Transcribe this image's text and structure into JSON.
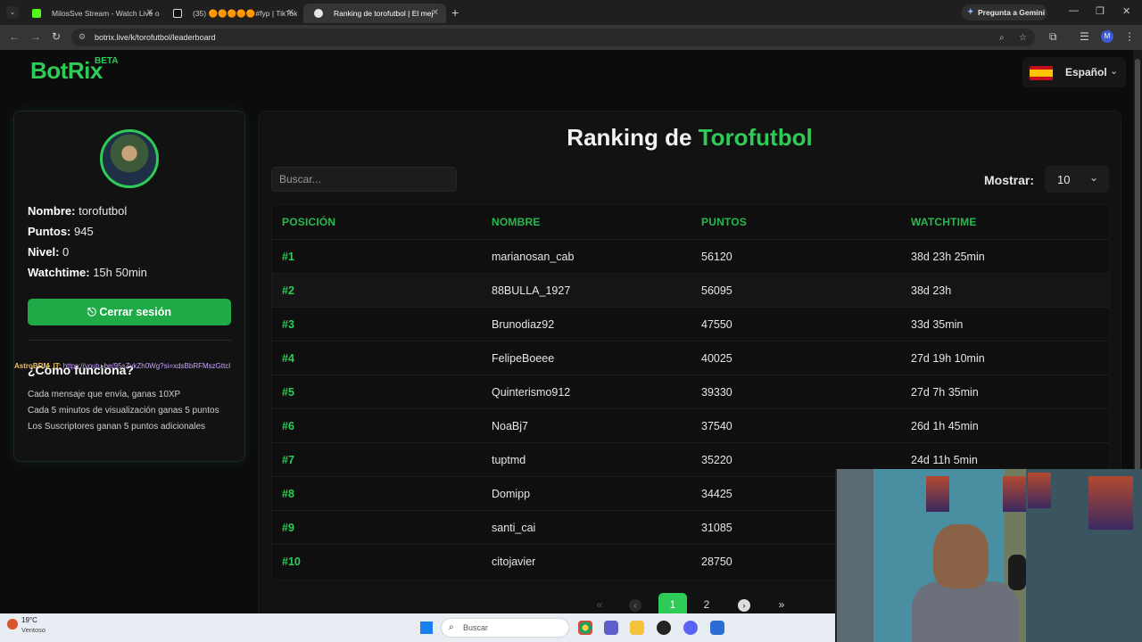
{
  "browser": {
    "tabs": [
      {
        "title": "MilosSve Stream - Watch Live o",
        "favicon_color": "#53fc18",
        "active": false
      },
      {
        "title": "(35) 🟠🟠🟠🟠🟠#fyp | TikTok",
        "favicon_color": "#ffffff",
        "active": false
      },
      {
        "title": "Ranking de torofutbol | El mej",
        "favicon_color": "#e6e6e6",
        "active": true
      }
    ],
    "gemini_label": "Pregunta a Gemini",
    "url": "botrix.live/k/torofutbol/leaderboard",
    "profile_initial": "M"
  },
  "site": {
    "logo": "BotRix",
    "beta": "BETA",
    "language": "Español"
  },
  "profile": {
    "name_label": "Nombre:",
    "name_value": "torofutbol",
    "points_label": "Puntos:",
    "points_value": "945",
    "level_label": "Nivel:",
    "level_value": "0",
    "watchtime_label": "Watchtime:",
    "watchtime_value": "15h 50min",
    "logout_label": "Cerrar sesión"
  },
  "how_it_works": {
    "title": "¿Cómo funciona?",
    "lines": [
      "Cada mensaje que envía, ganas 10XP",
      "Cada 5 minutos de visualización ganas 5 puntos",
      "Los Suscriptores ganan 5 puntos adicionales"
    ]
  },
  "chat_overlay": {
    "user": "AstroBRM_IT:",
    "text": "https://youtu.be/95sZykZh0Wg?si=xdsBbRFMszGttcl"
  },
  "leaderboard": {
    "title_prefix": "Ranking de",
    "title_name": "Torofutbol",
    "search_placeholder": "Buscar...",
    "show_label": "Mostrar:",
    "show_value": "10",
    "columns": [
      "POSICIÓN",
      "NOMBRE",
      "PUNTOS",
      "WATCHTIME"
    ],
    "rows": [
      {
        "pos": "#1",
        "name": "marianosan_cab",
        "points": "56120",
        "watchtime": "38d 23h 25min"
      },
      {
        "pos": "#2",
        "name": "88BULLA_1927",
        "points": "56095",
        "watchtime": "38d 23h"
      },
      {
        "pos": "#3",
        "name": "Brunodiaz92",
        "points": "47550",
        "watchtime": "33d 35min"
      },
      {
        "pos": "#4",
        "name": "FelipeBoeee",
        "points": "40025",
        "watchtime": "27d 19h 10min"
      },
      {
        "pos": "#5",
        "name": "Quinterismo912",
        "points": "39330",
        "watchtime": "27d 7h 35min"
      },
      {
        "pos": "#6",
        "name": "NoaBj7",
        "points": "37540",
        "watchtime": "26d 1h 45min"
      },
      {
        "pos": "#7",
        "name": "tuptmd",
        "points": "35220",
        "watchtime": "24d 11h 5min"
      },
      {
        "pos": "#8",
        "name": "Domipp",
        "points": "34425",
        "watchtime": ""
      },
      {
        "pos": "#9",
        "name": "santi_cai",
        "points": "31085",
        "watchtime": ""
      },
      {
        "pos": "#10",
        "name": "citojavier",
        "points": "28750",
        "watchtime": ""
      }
    ],
    "pagination": {
      "pages": [
        "1",
        "2"
      ],
      "current": "1"
    }
  },
  "taskbar": {
    "weather_temp": "19°C",
    "weather_desc": "Ventoso",
    "search_label": "Buscar"
  },
  "colors": {
    "accent": "#2ecc57",
    "background": "#0c0c0c",
    "panel": "#121212"
  }
}
